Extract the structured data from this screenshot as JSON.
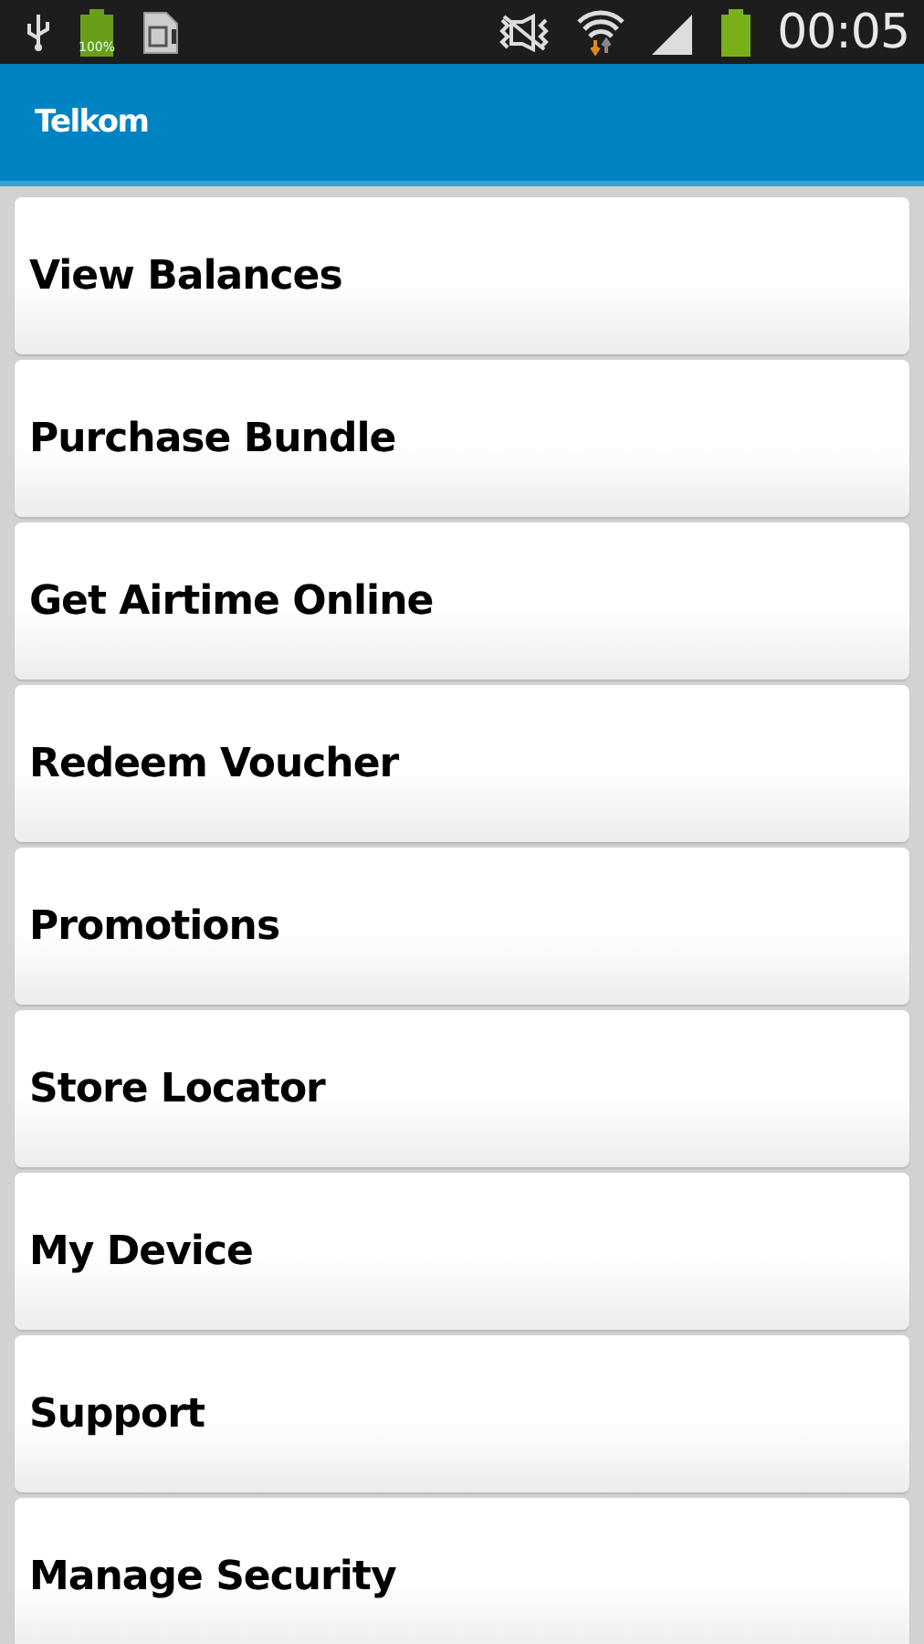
{
  "status_bar": {
    "battery_label": "100%",
    "time": "00:05"
  },
  "app_bar": {
    "title": "Telkom"
  },
  "menu": [
    {
      "label": "View Balances"
    },
    {
      "label": "Purchase Bundle"
    },
    {
      "label": "Get Airtime Online"
    },
    {
      "label": "Redeem Voucher"
    },
    {
      "label": "Promotions"
    },
    {
      "label": "Store Locator"
    },
    {
      "label": "My Device"
    },
    {
      "label": "Support"
    },
    {
      "label": "Manage Security"
    }
  ]
}
